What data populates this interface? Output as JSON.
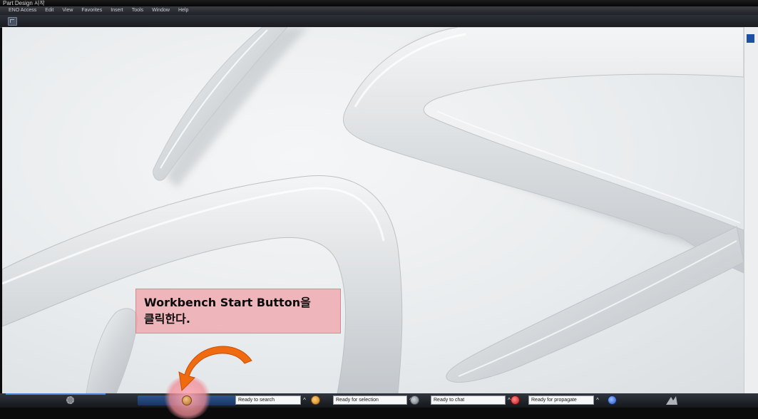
{
  "window": {
    "title": "Part Design 시작"
  },
  "menu": {
    "items": [
      "ENO Access",
      "Edit",
      "View",
      "Favorites",
      "Insert",
      "Tools",
      "Window",
      "Help"
    ]
  },
  "callout": {
    "line1": "Workbench Start Button을",
    "line2": "클릭한다."
  },
  "statusbar": {
    "fields": [
      {
        "text": "Ready to search",
        "icon": "search-agent-icon"
      },
      {
        "text": "Ready for selection",
        "icon": "selection-agent-icon"
      },
      {
        "text": "Ready to chat",
        "icon": "chat-agent-icon"
      },
      {
        "text": "Ready for propagate",
        "icon": "propagate-agent-icon"
      }
    ],
    "caret": "^"
  },
  "colors": {
    "callout_bg": "#EEA5AC",
    "arrow": "#F06A10",
    "compass": "#1F4FA2",
    "taskbar_accent": "#2C5590"
  },
  "icons": [
    "workbench-start-icon",
    "gear-icon",
    "brand-logo",
    "orange-curved-arrow"
  ]
}
